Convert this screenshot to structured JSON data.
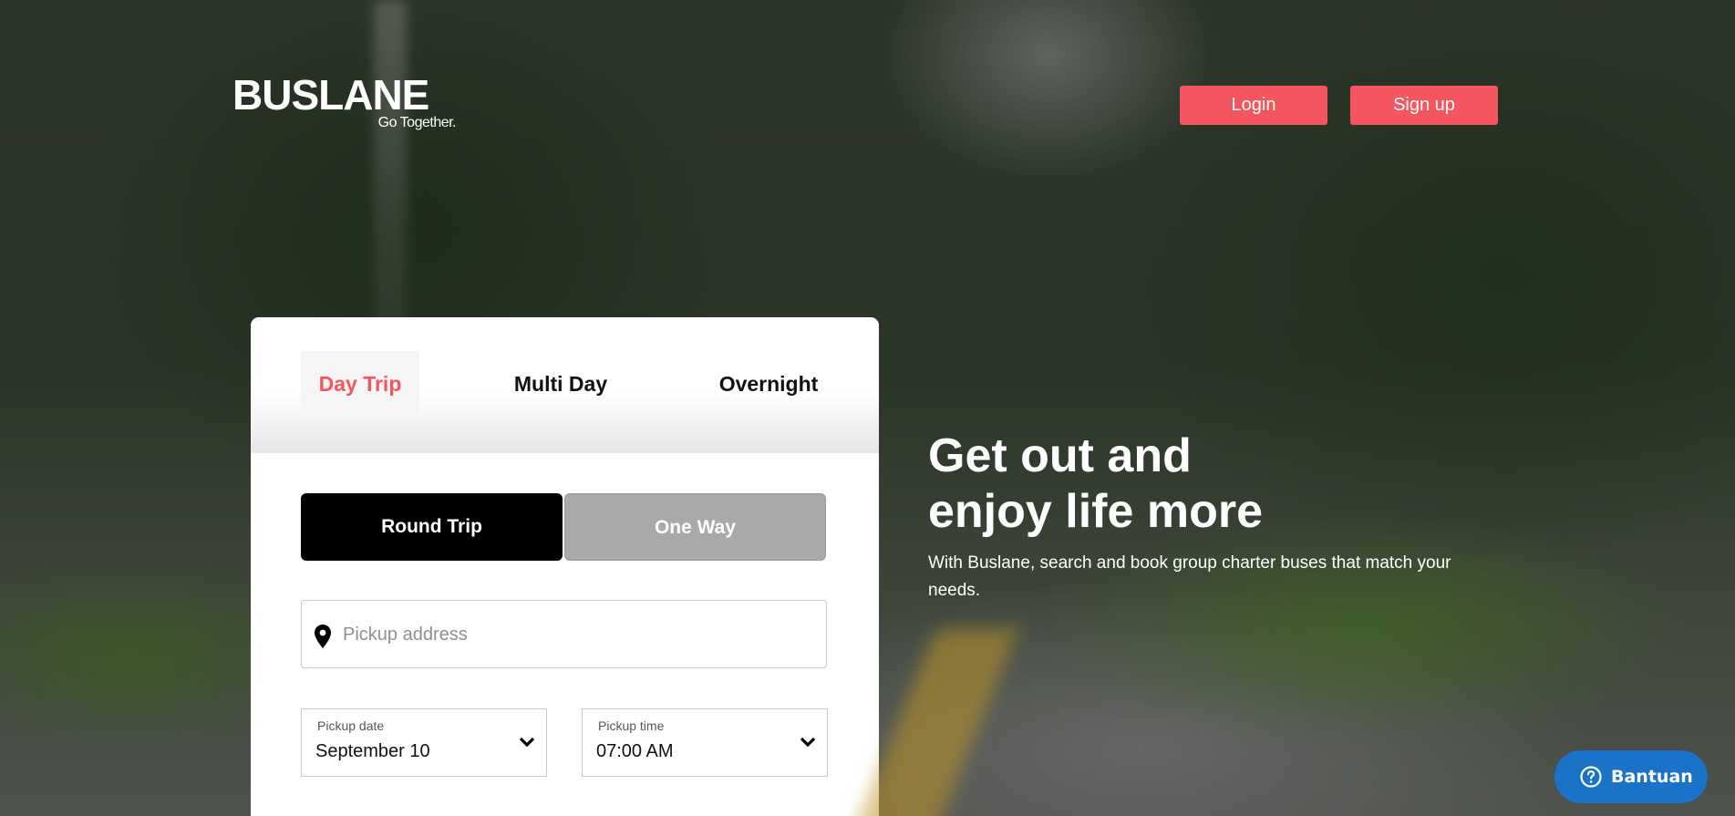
{
  "brand": {
    "name": "BUSLANE",
    "tagline": "Go Together."
  },
  "nav": {
    "login_label": "Login",
    "signup_label": "Sign up"
  },
  "trip_tabs": [
    {
      "label": "Day Trip",
      "active": true
    },
    {
      "label": "Multi Day",
      "active": false
    },
    {
      "label": "Overnight",
      "active": false
    }
  ],
  "trip_type": {
    "round_trip": "Round Trip",
    "one_way": "One Way",
    "selected": "Round Trip"
  },
  "pickup": {
    "placeholder": "Pickup address",
    "value": "",
    "icon": "map-pin-icon"
  },
  "pickup_date": {
    "label": "Pickup date",
    "value": "September 10"
  },
  "pickup_time": {
    "label": "Pickup time",
    "value": "07:00 AM"
  },
  "hero": {
    "headline_line1": "Get out and",
    "headline_line2": "enjoy life more",
    "subtext": "With Buslane, search and book group charter buses that match your needs."
  },
  "help": {
    "label": "Bantuan",
    "icon": "question-circle-icon"
  },
  "colors": {
    "accent": "#f4555f",
    "active_toggle": "#000000",
    "inactive_toggle": "#a9a9a9",
    "help_button": "#1a73c9"
  }
}
